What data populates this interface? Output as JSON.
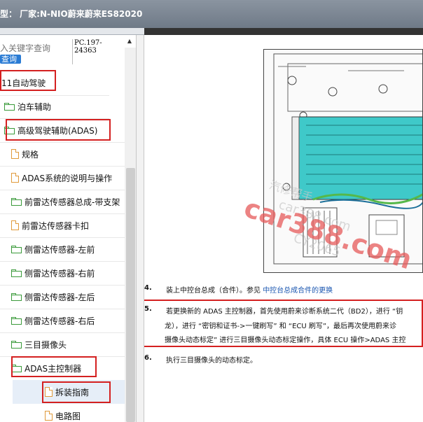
{
  "window": {
    "title": "型：  厂家:N-NIO蔚来蔚来ES82020"
  },
  "search": {
    "placeholder": "入关键字查询",
    "query_label": "查询"
  },
  "pc_code": {
    "line1": "PC.197-",
    "line2": "24363"
  },
  "tree": {
    "items": [
      {
        "label": "11自动驾驶",
        "icon": "none",
        "highlighted": true
      },
      {
        "label": "泊车辅助",
        "icon": "folder-icon"
      },
      {
        "label": "高级驾驶辅助(ADAS)",
        "icon": "folder-icon",
        "highlighted": true
      },
      {
        "label": "规格",
        "icon": "document-icon"
      },
      {
        "label": "ADAS系统的说明与操作",
        "icon": "document-icon"
      },
      {
        "label": "前雷达传感器总成-带支架",
        "icon": "folder-icon"
      },
      {
        "label": "前雷达传感器卡扣",
        "icon": "document-icon"
      },
      {
        "label": "侧雷达传感器-左前",
        "icon": "folder-icon"
      },
      {
        "label": "侧雷达传感器-右前",
        "icon": "folder-icon"
      },
      {
        "label": "侧雷达传感器-左后",
        "icon": "folder-icon"
      },
      {
        "label": "侧雷达传感器-右后",
        "icon": "folder-icon"
      },
      {
        "label": "三目摄像头",
        "icon": "folder-icon"
      },
      {
        "label": "ADAS主控制器",
        "icon": "folder-icon",
        "highlighted": true
      },
      {
        "label": "拆装指南",
        "icon": "document-icon",
        "highlighted": true,
        "selected": true
      },
      {
        "label": "电路图",
        "icon": "document-icon"
      }
    ]
  },
  "document": {
    "steps": [
      {
        "num": "4.",
        "text": "装上中控台总成（合件）。参见 ",
        "link": "中控台总成合件的更换"
      },
      {
        "num": "5.",
        "line1": "若更换新的 ADAS 主控制器，首先使用蔚来诊断系统二代（BD2），进行 “钥",
        "line2": "龙），进行 “密钥和证书->一键刷写” 和 “ECU 刷写”，最后再次使用蔚来诊",
        "line3": "摄像头动态标定” 进行三目摄像头动态标定操作，具体 ECU 操作>ADAS 主控"
      },
      {
        "num": "6.",
        "text": "执行三目摄像头的动态标定。"
      }
    ]
  },
  "watermark": {
    "main": "car388.com",
    "faint1": "汽修帮手",
    "faint2": "car388.com",
    "faint3": "CY2065"
  },
  "colors": {
    "highlight": "#d42020",
    "link": "#1a56b0",
    "ecu_teal": "#3fc9c9"
  }
}
